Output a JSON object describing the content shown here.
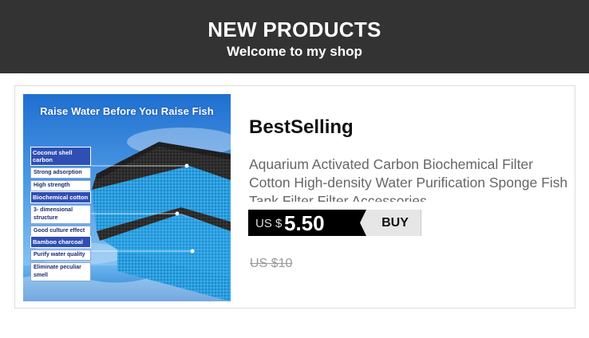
{
  "header": {
    "title": "NEW PRODUCTS",
    "subtitle": "Welcome to my shop"
  },
  "product": {
    "image": {
      "heading": "Raise Water Before You Raise Fish",
      "features": [
        {
          "title": "Coconut shell carbon",
          "lines": [
            "Strong adsorption",
            "High strength"
          ]
        },
        {
          "title": "Biochemical cotton",
          "lines": [
            "3- dimensional structure",
            "Good culture effect"
          ]
        },
        {
          "title": "Bamboo charcoal",
          "lines": [
            "Purify water quality",
            "Eliminate peculiar smell"
          ]
        }
      ]
    },
    "brand": "BestSelling",
    "description": "Aquarium Activated Carbon Biochemical Filter Cotton High-density Water Purification Sponge Fish Tank Filter Filter Accessories",
    "price_currency": "US $",
    "price_amount": "5.50",
    "buy_label": "BUY",
    "old_price": "US $10"
  },
  "colors": {
    "header_bg": "#333333",
    "price_bg": "#000000",
    "buy_bg": "#e6e6e6",
    "old_price": "#999999"
  }
}
